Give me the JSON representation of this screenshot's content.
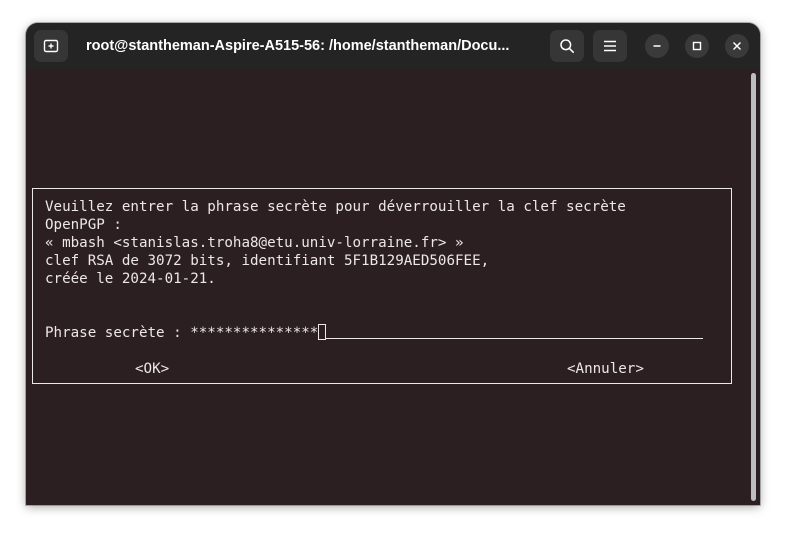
{
  "window": {
    "title": "root@stantheman-Aspire-A515-56: /home/stantheman/Docu..."
  },
  "titlebar_icons": {
    "new_tab": "new-tab-icon",
    "search": "search-icon",
    "menu": "hamburger-menu-icon",
    "minimize": "minimize-icon",
    "maximize": "maximize-icon",
    "close": "close-icon"
  },
  "dialog": {
    "lines": [
      "Veuillez entrer la phrase secrète pour déverrouiller la clef secrète",
      "OpenPGP :",
      "« mbash <stanislas.troha8@etu.univ-lorraine.fr> »",
      "clef RSA de 3072 bits, identifiant 5F1B129AED506FEE,",
      "créée le 2024-01-21."
    ],
    "prompt_label": "Phrase secrète : ",
    "masked_value": "***************",
    "ok_label": "<OK>",
    "cancel_label": "<Annuler>"
  },
  "colors": {
    "terminal_bg": "#2c1f21",
    "titlebar_bg": "#242424",
    "text": "#ece7e9"
  }
}
